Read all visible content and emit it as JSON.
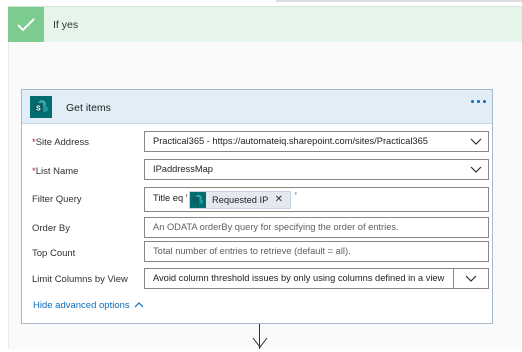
{
  "branch": {
    "title": "If yes"
  },
  "action": {
    "title": "Get items",
    "icon": "sharepoint-icon",
    "more_icon": "ellipsis-icon",
    "fields": {
      "site_address": {
        "label": "Site Address",
        "required": "*",
        "value": "Practical365 - https://automateiq.sharepoint.com/sites/Practical365"
      },
      "list_name": {
        "label": "List Name",
        "required": "*",
        "value": "IPaddressMap"
      },
      "filter_query": {
        "label": "Filter Query",
        "prefix": "Title eq '",
        "token": "Requested IP",
        "suffix": "'"
      },
      "order_by": {
        "label": "Order By",
        "placeholder": "An ODATA orderBy query for specifying the order of entries."
      },
      "top_count": {
        "label": "Top Count",
        "placeholder": "Total number of entries to retrieve (default = all)."
      },
      "limit_columns": {
        "label": "Limit Columns by View",
        "value": "Avoid column threshold issues by only using columns defined in a view"
      }
    },
    "advanced_label": "Hide advanced options"
  },
  "colors": {
    "success_green": "#7dcc8f",
    "branch_header_bg": "#e6f5ea",
    "card_header_bg": "#e1eef7",
    "sharepoint_teal": "#036c70",
    "link_blue": "#0f6cbd",
    "required_red": "#a4262c"
  }
}
